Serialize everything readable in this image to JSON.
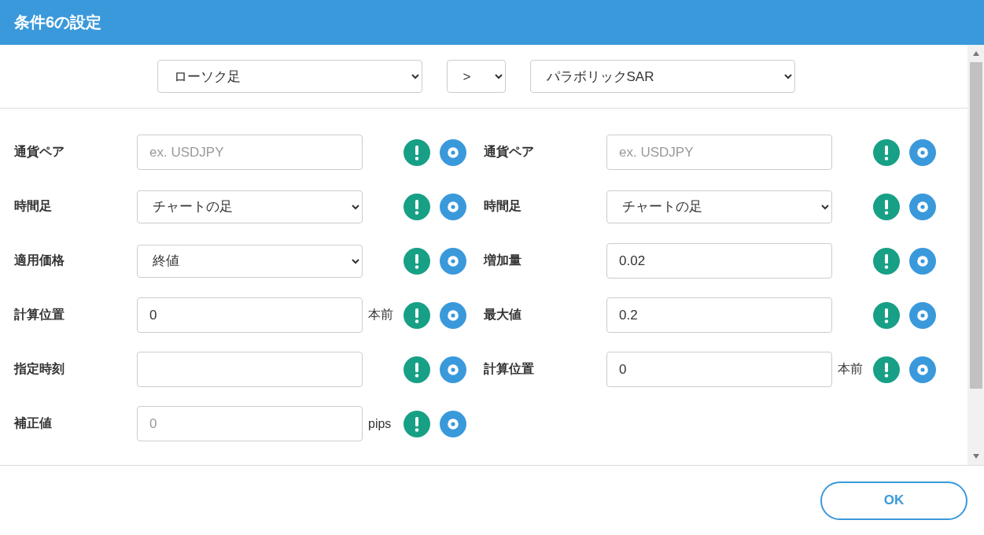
{
  "window": {
    "title": "条件6の設定"
  },
  "comparison": {
    "left": "ローソク足",
    "operator": ">",
    "right": "パラボリックSAR"
  },
  "left_fields": [
    {
      "label": "通貨ペア",
      "kind": "text",
      "placeholder": "ex. USDJPY"
    },
    {
      "label": "時間足",
      "kind": "select",
      "value": "チャートの足"
    },
    {
      "label": "適用価格",
      "kind": "select",
      "value": "終値"
    },
    {
      "label": "計算位置",
      "kind": "text",
      "value": "0",
      "unit": "本前"
    },
    {
      "label": "指定時刻",
      "kind": "text"
    },
    {
      "label": "補正値",
      "kind": "text",
      "placeholder": "0",
      "unit": "pips"
    }
  ],
  "right_fields": [
    {
      "label": "通貨ペア",
      "kind": "text",
      "placeholder": "ex. USDJPY"
    },
    {
      "label": "時間足",
      "kind": "select",
      "value": "チャートの足"
    },
    {
      "label": "増加量",
      "kind": "text",
      "value": "0.02"
    },
    {
      "label": "最大値",
      "kind": "text",
      "value": "0.2"
    },
    {
      "label": "計算位置",
      "kind": "text",
      "value": "0",
      "unit": "本前"
    }
  ],
  "buttons": [
    "OK"
  ]
}
